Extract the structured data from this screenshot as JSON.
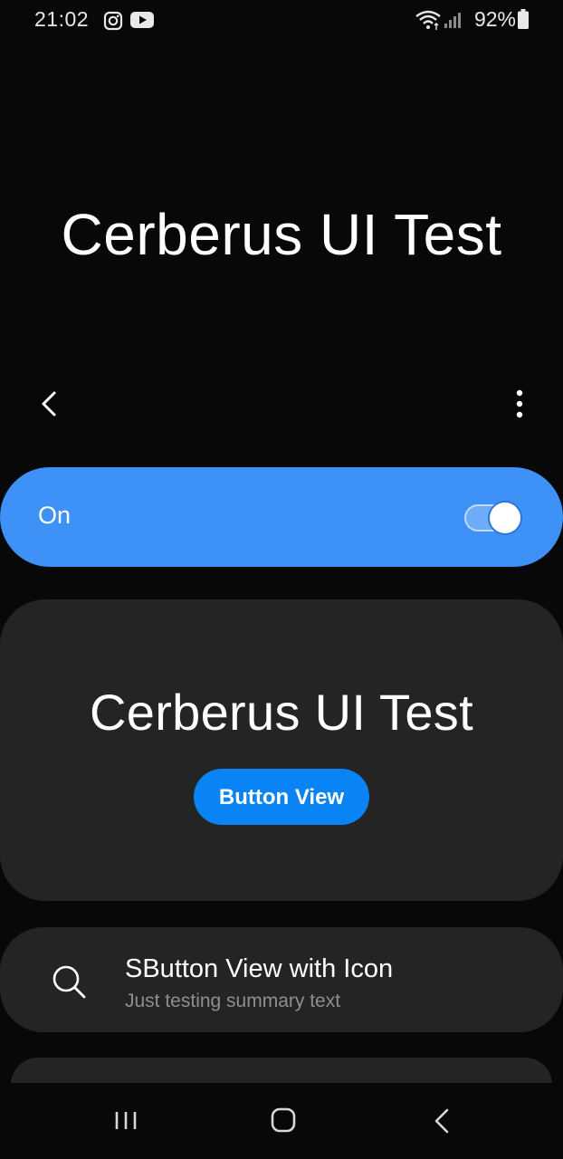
{
  "status_bar": {
    "time": "21:02",
    "battery": "92%",
    "icons": [
      "instagram-icon",
      "youtube-icon",
      "wifi-icon",
      "cell-signal-icon",
      "battery-icon"
    ]
  },
  "header": {
    "large_title": "Cerberus UI Test",
    "back_icon": "chevron-left-icon",
    "more_icon": "more-vertical-icon"
  },
  "switch_bar": {
    "label": "On",
    "checked": true,
    "accent_color": "#3e91f7"
  },
  "card": {
    "title": "Cerberus UI Test",
    "button_label": "Button View",
    "button_color": "#0a84f5"
  },
  "list": {
    "items": [
      {
        "icon": "search-icon",
        "title": "SButton View with Icon",
        "summary": "Just testing summary text"
      }
    ]
  },
  "nav_bar": {
    "buttons": [
      "recents-icon",
      "home-icon",
      "back-icon"
    ]
  }
}
